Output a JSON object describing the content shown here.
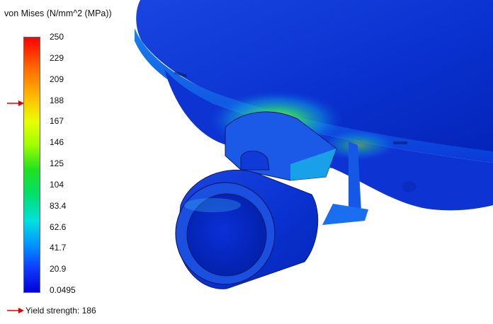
{
  "legend": {
    "title": "von Mises (N/mm^2 (MPa))",
    "ticks": [
      "250",
      "229",
      "209",
      "188",
      "167",
      "146",
      "125",
      "104",
      "83.4",
      "62.6",
      "41.7",
      "20.9",
      "0.0495"
    ],
    "yield_label": "Yield strength: 186",
    "marker_color": "#e00000"
  },
  "model": {
    "low_color": "#0a2fd6",
    "mid_color": "#00c8c8",
    "high_color": "#c8ff00"
  }
}
